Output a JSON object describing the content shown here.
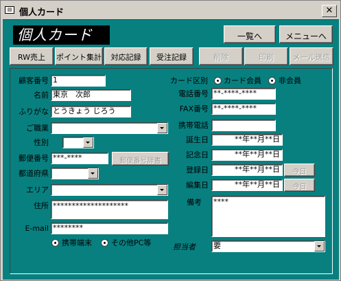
{
  "window": {
    "title": "個人カード",
    "icon": "form-icon",
    "close_glyph": "✕"
  },
  "banner": "個人カード",
  "nav": {
    "list_button": "一覧へ",
    "menu_button": "メニューへ"
  },
  "toolbar": [
    {
      "label": "RW売上",
      "enabled": true
    },
    {
      "label": "ポイント集計",
      "enabled": true
    },
    {
      "label": "対応記録",
      "enabled": true
    },
    {
      "label": "受注記録",
      "enabled": true
    },
    {
      "label": "削除",
      "enabled": false
    },
    {
      "label": "印刷",
      "enabled": false
    },
    {
      "label": "メール送信",
      "enabled": false
    }
  ],
  "left": {
    "customer_no": {
      "label": "顧客番号",
      "value": "1"
    },
    "name": {
      "label": "名前",
      "value": "東京　次郎"
    },
    "furigana": {
      "label": "ふりがな",
      "value": "とうきょう じろう"
    },
    "occupation": {
      "label": "ご職業",
      "value": ""
    },
    "gender": {
      "label": "性別",
      "value": ""
    },
    "postal": {
      "label": "郵便番号",
      "value": "***-****",
      "lookup_button": "郵便番号辞書"
    },
    "prefecture": {
      "label": "都道府県",
      "value": ""
    },
    "area": {
      "label": "エリア",
      "value": ""
    },
    "address": {
      "label": "住所",
      "value": "********************"
    },
    "email": {
      "label": "E-mail",
      "value": "********"
    },
    "email_type": {
      "option1": "携帯端末",
      "option2": "その他PC等",
      "selected": "option1"
    }
  },
  "right": {
    "card_type": {
      "label": "カード区別",
      "option1": "カード会員",
      "option2": "非会員",
      "selected": "option1"
    },
    "phone": {
      "label": "電話番号",
      "value": "**-****-****"
    },
    "fax": {
      "label": "FAX番号",
      "value": "**-****-****"
    },
    "mobile": {
      "label": "携帯電話",
      "value": ""
    },
    "birthday": {
      "label": "誕生日",
      "value": "**年**月**日"
    },
    "anniversary": {
      "label": "記念日",
      "value": "**年**月**日"
    },
    "registered": {
      "label": "登録日",
      "value": "**年**月**日",
      "today_button": "今日"
    },
    "edited": {
      "label": "編集日",
      "value": "**年**月**日",
      "today_button": "今日"
    },
    "notes": {
      "label": "備考",
      "value": "****"
    },
    "staff": {
      "label": "担当者",
      "value": "要"
    }
  }
}
